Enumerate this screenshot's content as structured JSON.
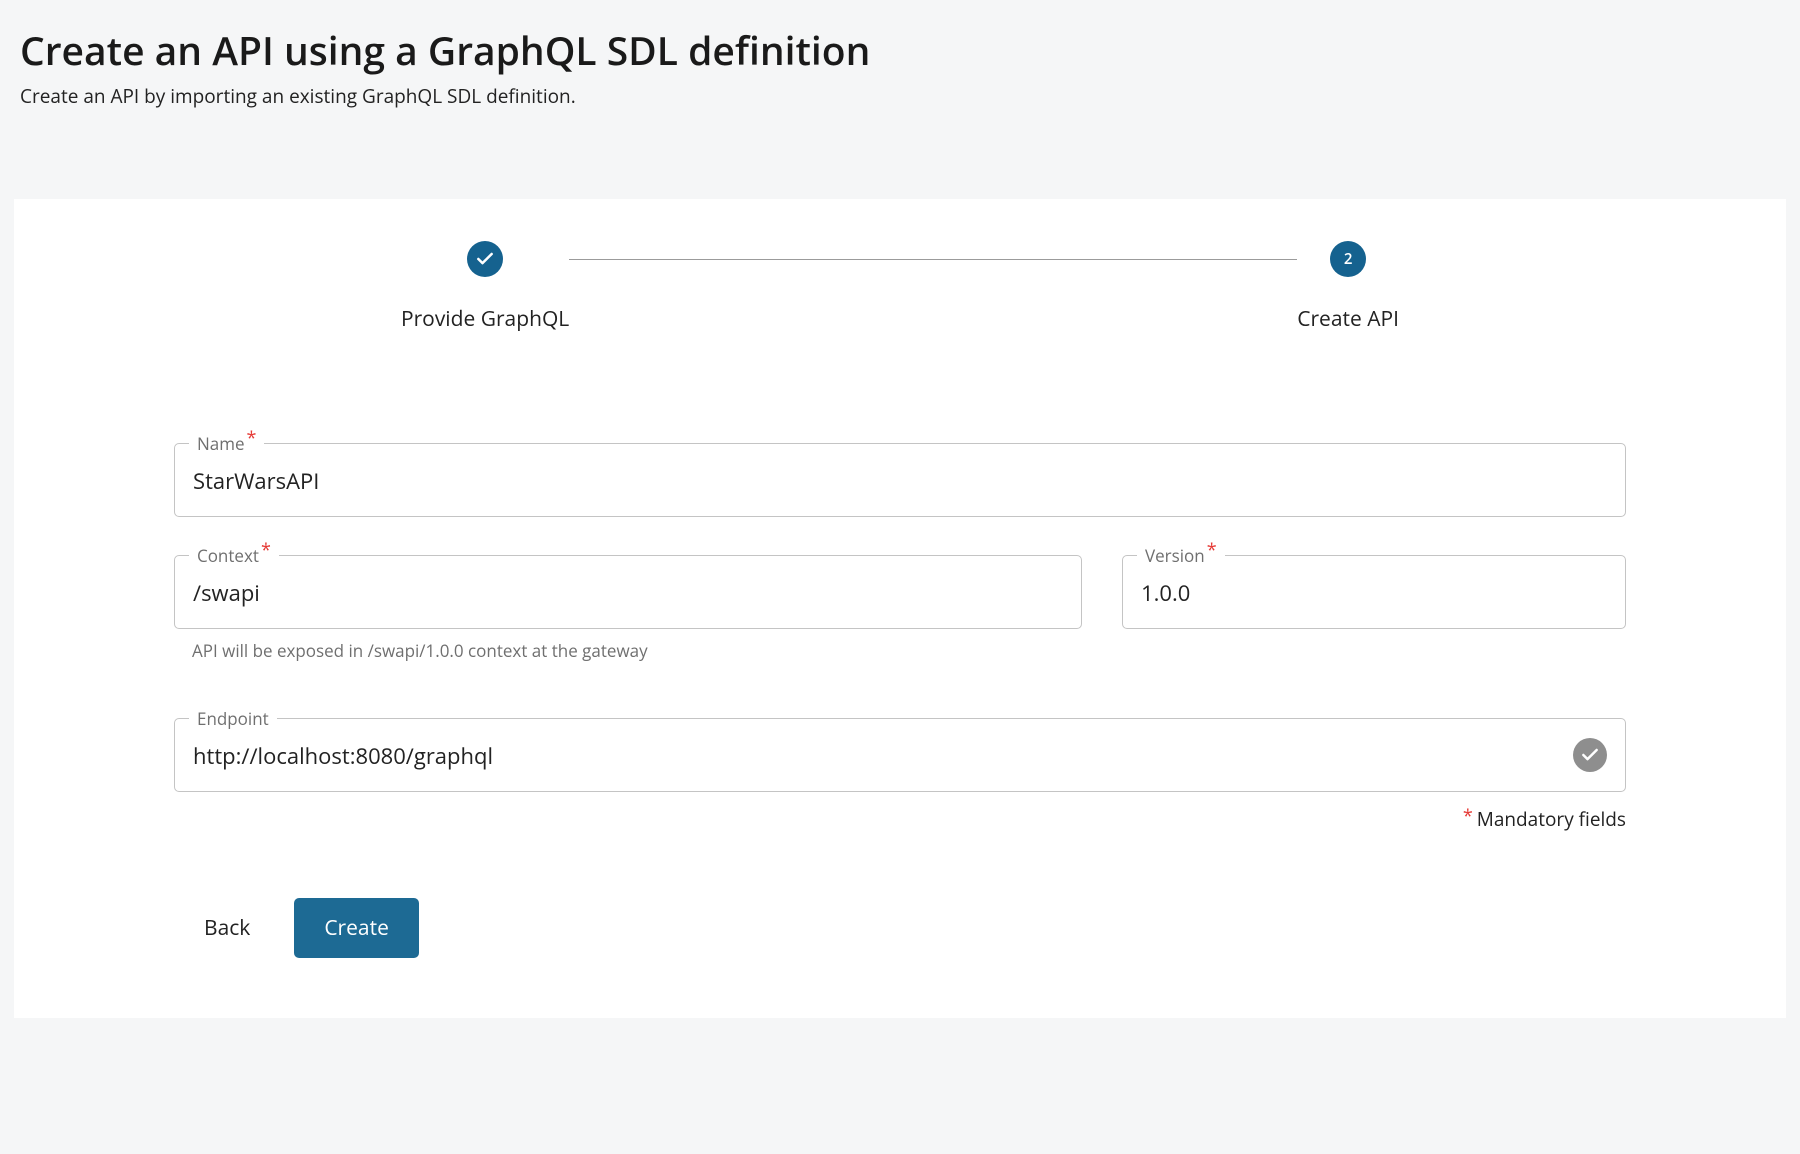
{
  "header": {
    "title": "Create an API using a GraphQL SDL definition",
    "subtitle": "Create an API by importing an existing GraphQL SDL definition."
  },
  "stepper": {
    "step1": {
      "label": "Provide GraphQL",
      "completed": true
    },
    "step2": {
      "label": "Create API",
      "number": "2"
    }
  },
  "form": {
    "name": {
      "label": "Name",
      "value": "StarWarsAPI"
    },
    "context": {
      "label": "Context",
      "value": "/swapi",
      "helper": "API will be exposed in /swapi/1.0.0 context at the gateway"
    },
    "version": {
      "label": "Version",
      "value": "1.0.0"
    },
    "endpoint": {
      "label": "Endpoint",
      "value": "http://localhost:8080/graphql"
    },
    "mandatory_note": "Mandatory fields"
  },
  "actions": {
    "back": "Back",
    "create": "Create"
  }
}
